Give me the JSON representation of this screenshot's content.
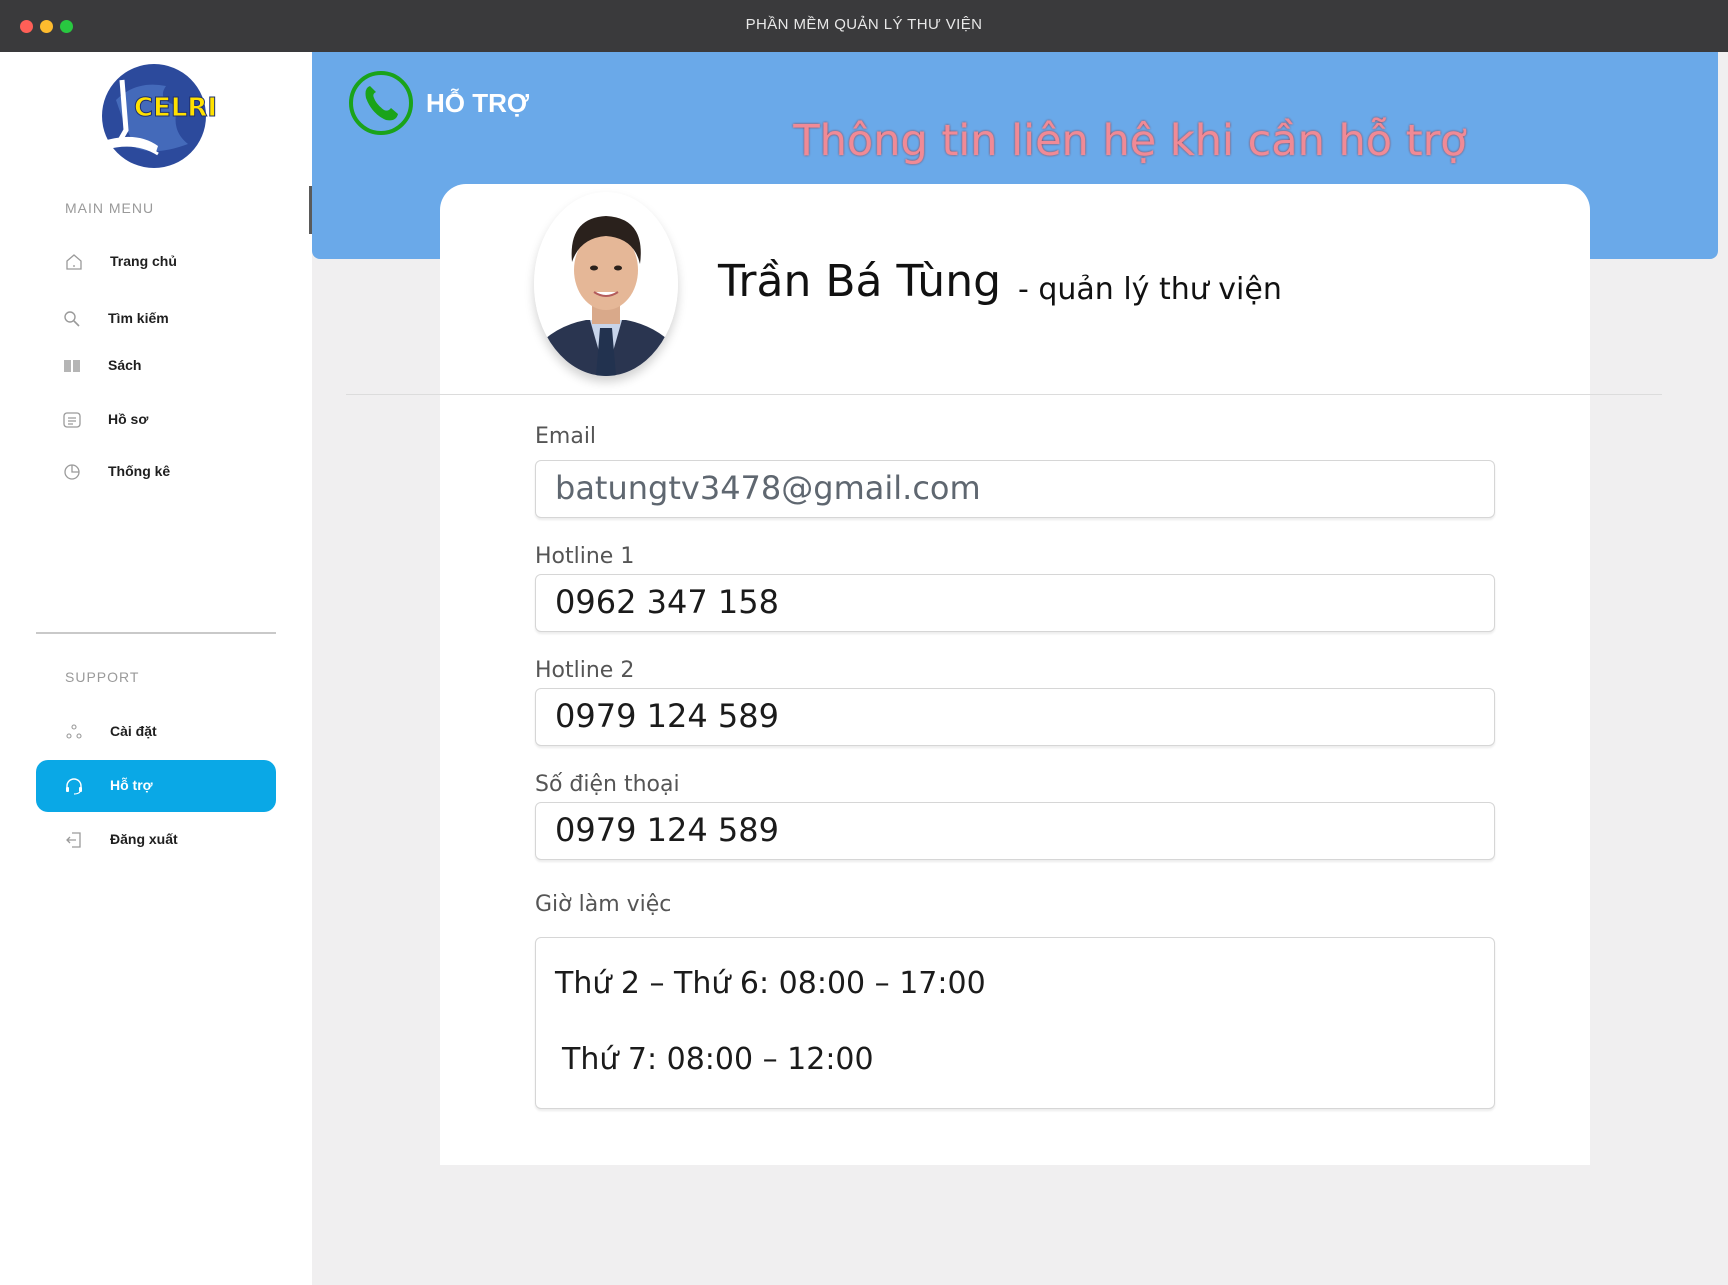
{
  "window": {
    "title": "PHẦN MỀM QUẢN LÝ THƯ VIỆN"
  },
  "sidebar": {
    "logo_text": "CELRI",
    "main_menu_label": "MAIN MENU",
    "main_items": [
      {
        "label": "Trang chủ",
        "icon": "home-icon"
      },
      {
        "label": "Tìm kiếm",
        "icon": "search-icon"
      },
      {
        "label": "Sách",
        "icon": "book-icon"
      },
      {
        "label": "Hồ sơ",
        "icon": "profile-icon"
      },
      {
        "label": "Thống kê",
        "icon": "chart-icon"
      }
    ],
    "support_label": "SUPPORT",
    "support_items": [
      {
        "label": "Cài đặt",
        "icon": "settings-icon"
      },
      {
        "label": "Hỗ trợ",
        "icon": "headset-icon",
        "active": true
      },
      {
        "label": "Đăng xuất",
        "icon": "logout-icon"
      }
    ]
  },
  "header": {
    "icon": "phone-icon",
    "title": "HỖ TRỢ",
    "subtitle": "Thông tin liên hệ khi cần hỗ trợ"
  },
  "contact": {
    "name": "Trần Bá Tùng",
    "role": "- quản lý thư viện",
    "email_label": "Email",
    "email": "batungtv3478@gmail.com",
    "hotline1_label": "Hotline 1",
    "hotline1": "0962 347 158",
    "hotline2_label": "Hotline 2",
    "hotline2": "0979 124 589",
    "phone_label": "Số điện thoại",
    "phone": "0979 124 589",
    "hours_label": "Giờ làm việc",
    "hours": [
      "Thứ 2 – Thứ 6: 08:00 – 17:00",
      "Thứ 7: 08:00 – 12:00"
    ]
  },
  "colors": {
    "banner": "#6aa9e9",
    "active_nav": "#0aa8e6",
    "subtitle": "#f08a96",
    "phone_icon": "#1aa31a"
  }
}
